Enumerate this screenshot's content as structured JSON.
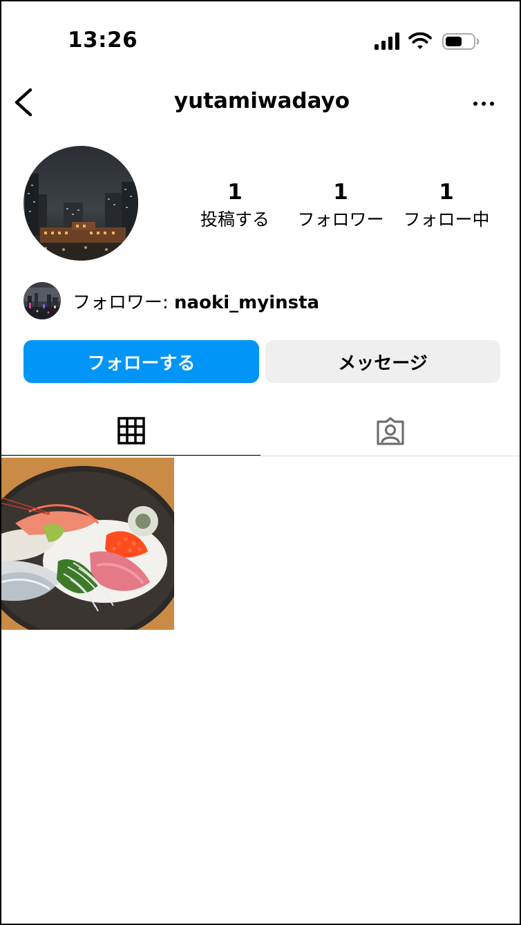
{
  "status_bar": {
    "time": "13:26"
  },
  "header": {
    "username": "yutamiwadayo"
  },
  "stats": [
    {
      "value": "1",
      "label": "投稿する"
    },
    {
      "value": "1",
      "label": "フォロワー"
    },
    {
      "value": "1",
      "label": "フォロー中"
    }
  ],
  "followed_by": {
    "prefix": "フォロワー: ",
    "name": "naoki_myinsta"
  },
  "buttons": {
    "follow": "フォローする",
    "message": "メッセージ"
  },
  "tabs": {
    "active": "grid"
  },
  "colors": {
    "accent": "#0095f6",
    "secondary_button": "#efefef",
    "divider": "#dbdbdb"
  },
  "icons": [
    "back-chevron-icon",
    "more-icon",
    "grid-icon",
    "tagged-person-icon",
    "signal-icon",
    "wifi-icon",
    "battery-icon"
  ]
}
